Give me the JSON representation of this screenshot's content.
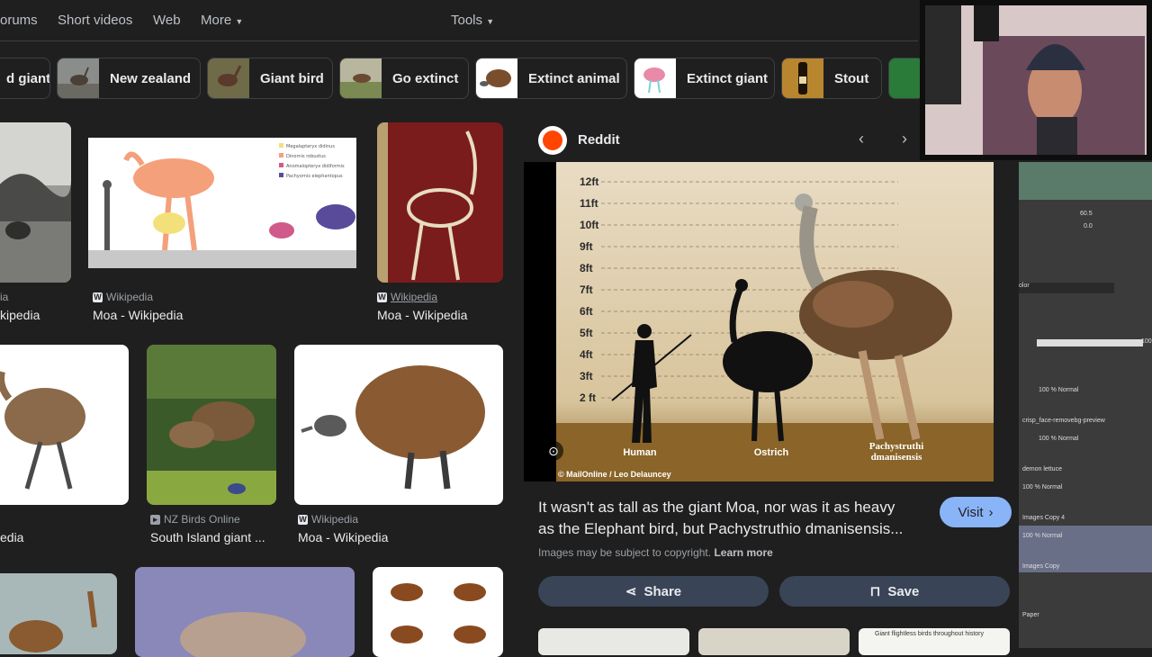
{
  "nav": {
    "items": [
      "orums",
      "Short videos",
      "Web",
      "More"
    ],
    "tools_label": "Tools"
  },
  "chips": [
    {
      "label": "d giant"
    },
    {
      "label": "New zealand"
    },
    {
      "label": "Giant bird"
    },
    {
      "label": "Go extinct"
    },
    {
      "label": "Extinct animal"
    },
    {
      "label": "Extinct giant"
    },
    {
      "label": "Stout"
    }
  ],
  "results": {
    "row1": [
      {
        "source": "ia",
        "title": "kipedia"
      },
      {
        "source": "Wikipedia",
        "title": "Moa - Wikipedia"
      },
      {
        "source": "Wikipedia",
        "title": "Moa - Wikipedia"
      }
    ],
    "row2": [
      {
        "source": "",
        "title": "edia"
      },
      {
        "source": "NZ Birds Online",
        "title": "South Island giant ..."
      },
      {
        "source": "Wikipedia",
        "title": "Moa - Wikipedia"
      }
    ],
    "legend_items": [
      "Megalapteryx didinus",
      "Dinornis robustus",
      "Anomalopteryx didiformis",
      "Pachyornis elephantopus"
    ]
  },
  "preview": {
    "site_name": "Reddit",
    "height_labels": [
      "12ft",
      "11ft",
      "10ft",
      "9ft",
      "8ft",
      "7ft",
      "6ft",
      "5ft",
      "4ft",
      "3ft",
      "2 ft"
    ],
    "figure_labels": {
      "human": "Human",
      "ostrich": "Ostrich",
      "pachy1": "Pachystruthi",
      "pachy2": "dmanisensis"
    },
    "credit": "© MailOnline / Leo Delauncey",
    "caption_line1": "It wasn't as tall as the giant Moa, nor was it as heavy",
    "caption_line2": "as the Elephant bird, but Pachystruthio dmanisensis...",
    "visit_label": "Visit",
    "copyright_note": "Images may be subject to copyright.",
    "learn_more": "Learn more",
    "share_label": "Share",
    "save_label": "Save",
    "related_caption": "Giant flightless birds throughout history"
  },
  "app_panel": {
    "zoom1": "60.5",
    "zoom2": "0.0",
    "blend_label": "olor",
    "opacity": "100",
    "layers": [
      {
        "name": "",
        "mode": "100 % Normal"
      },
      {
        "name": "crisp_face-removebg-preview",
        "mode": "100 % Normal"
      },
      {
        "name": "demon lettuce",
        "mode": "100 % Normal"
      },
      {
        "name": "Images Copy 4",
        "mode": "100 % Normal"
      },
      {
        "name": "Images Copy",
        "mode": ""
      },
      {
        "name": "Paper",
        "mode": ""
      }
    ]
  },
  "colors": {
    "background": "#1f1f1f",
    "pill": "#394457",
    "visit": "#8ab4f8",
    "reddit": "#ff4500"
  }
}
